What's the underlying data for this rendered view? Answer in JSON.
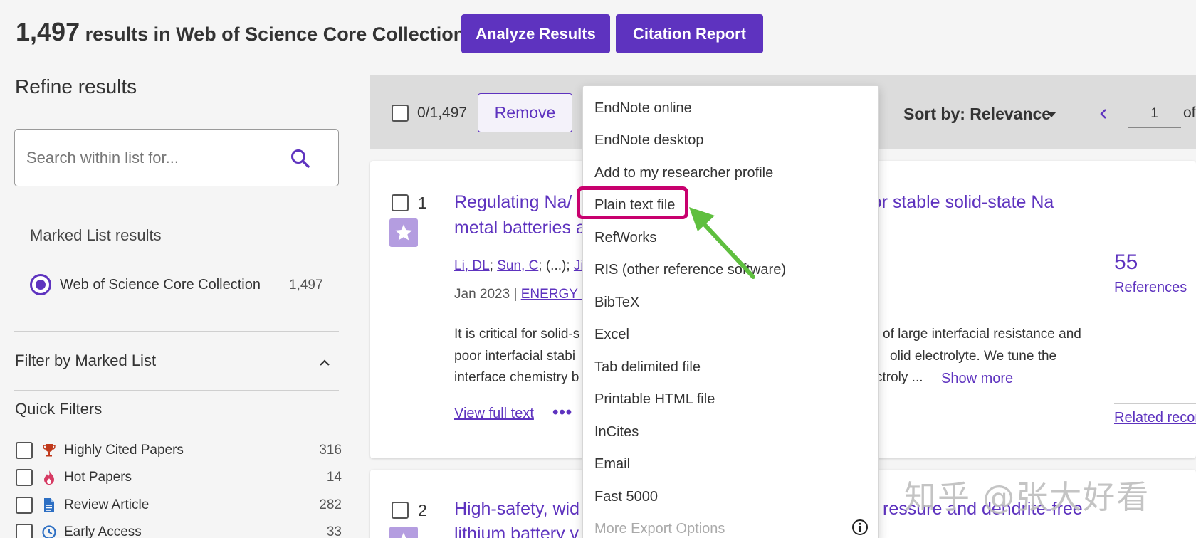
{
  "header": {
    "result_count": "1,497",
    "result_text": " results in Web of Science Core Collection",
    "analyze_label": "Analyze Results",
    "citation_label": "Citation Report"
  },
  "sidebar": {
    "refine_title": "Refine results",
    "search_placeholder": "Search within list for...",
    "marked_list_title": "Marked List results",
    "wos_label": "Web of Science Core Collection",
    "wos_count": "1,497",
    "filter_title": "Filter by Marked List",
    "quick_filters_title": "Quick Filters",
    "quick_filters": [
      {
        "label": "Highly Cited Papers",
        "count": "316",
        "icon": "trophy-icon"
      },
      {
        "label": "Hot Papers",
        "count": "14",
        "icon": "flame-icon"
      },
      {
        "label": "Review Article",
        "count": "282",
        "icon": "document-icon"
      },
      {
        "label": "Early Access",
        "count": "33",
        "icon": "clock-icon"
      }
    ]
  },
  "toolbar": {
    "selected_count": "0/1,497",
    "remove_label": "Remove",
    "sort_label": "Sort by: Relevance",
    "page_value": "1",
    "page_of": "of"
  },
  "records": [
    {
      "number": "1",
      "title_line1": "Regulating Na/",
      "title_line1_end": "try for stable solid-state Na",
      "title_line2": "metal batteries a",
      "author1": "Li, DL",
      "author2": "Sun, C",
      "authors_sep": " (...); ",
      "author3": "Jin",
      "date": "Jan 2023 | ",
      "journal": "ENERGY ST",
      "abstract_l1a": "It is critical for solid-s",
      "abstract_l1b": "of large interfacial resistance and",
      "abstract_l2a": "poor interfacial stabi",
      "abstract_l2b": "olid electrolyte. We tune the",
      "abstract_l3a": "interface chemistry b",
      "abstract_l3b": "ctroly ...",
      "show_more": "Show more",
      "view_full_text": "View full text",
      "more_dots": "•••",
      "references_count": "55",
      "references_label": "References",
      "related_label": "Related records"
    },
    {
      "number": "2",
      "title_line1": "High-safety, wid",
      "title_line1_end": "ressure and dendrite-free",
      "title_line2": "lithium battery v"
    }
  ],
  "export_menu": {
    "items": [
      "EndNote online",
      "EndNote desktop",
      "Add to my researcher profile",
      "Plain text file",
      "RefWorks",
      "RIS (other reference software)",
      "BibTeX",
      "Excel",
      "Tab delimited file",
      "Printable HTML file",
      "InCites",
      "Email",
      "Fast 5000"
    ],
    "more_options": "More Export Options",
    "highlighted_item": "Plain text file"
  },
  "annotation": {
    "highlight_color": "#c8006e",
    "arrow_color": "#5fbf3f"
  },
  "watermark": "知乎 @张大好看",
  "colors": {
    "accent": "#5e33bf",
    "star": "#b49de0"
  }
}
